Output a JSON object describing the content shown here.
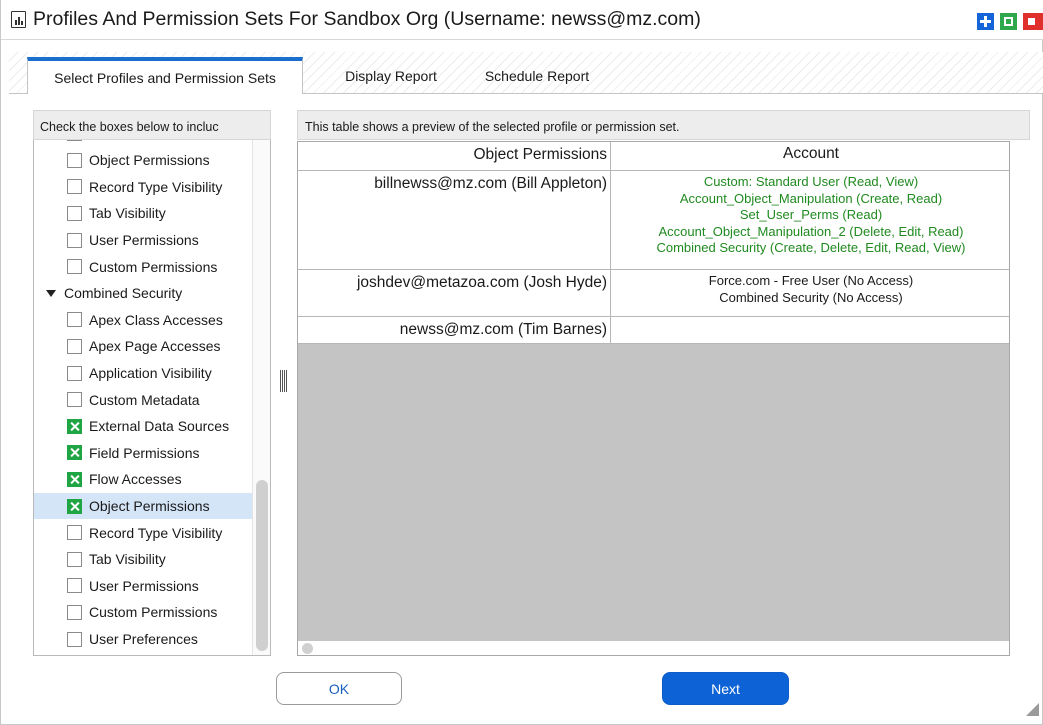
{
  "window": {
    "title": "Profiles And Permission Sets For Sandbox Org (Username: newss@mz.com)",
    "controls": [
      "maximize-icon",
      "restore-icon",
      "close-icon"
    ],
    "accent_colors": {
      "maximize": "#1565d8",
      "restore": "#2ea84a",
      "close": "#e0302c"
    }
  },
  "tabs": [
    {
      "label": "Select Profiles and Permission Sets",
      "active": true
    },
    {
      "label": "Display Report",
      "active": false
    },
    {
      "label": "Schedule Report",
      "active": false
    }
  ],
  "left_panel": {
    "header": "Check the boxes below to incluc",
    "items": [
      {
        "label": "Object Permissions",
        "checked": false
      },
      {
        "label": "Record Type Visibility",
        "checked": false
      },
      {
        "label": "Tab Visibility",
        "checked": false
      },
      {
        "label": "User Permissions",
        "checked": false
      },
      {
        "label": "Custom Permissions",
        "checked": false
      }
    ],
    "group": {
      "label": "Combined Security",
      "expanded": true
    },
    "group_items": [
      {
        "label": "Apex Class Accesses",
        "checked": false
      },
      {
        "label": "Apex Page Accesses",
        "checked": false
      },
      {
        "label": "Application Visibility",
        "checked": false
      },
      {
        "label": "Custom Metadata",
        "checked": false
      },
      {
        "label": "External Data Sources",
        "checked": true
      },
      {
        "label": "Field Permissions",
        "checked": true
      },
      {
        "label": "Flow Accesses",
        "checked": true
      },
      {
        "label": "Object Permissions",
        "checked": true,
        "selected": true
      },
      {
        "label": "Record Type Visibility",
        "checked": false
      },
      {
        "label": "Tab Visibility",
        "checked": false
      },
      {
        "label": "User Permissions",
        "checked": false
      },
      {
        "label": "Custom Permissions",
        "checked": false
      },
      {
        "label": "User Preferences",
        "checked": false
      }
    ]
  },
  "right_panel": {
    "header": "This table shows a preview of the selected profile or permission set.",
    "columns": [
      "Object Permissions",
      "Account"
    ],
    "rows": [
      {
        "user": "billnewss@mz.com (Bill Appleton)",
        "tone": "green",
        "lines": [
          "Custom: Standard User (Read, View)",
          "Account_Object_Manipulation (Create, Read)",
          "Set_User_Perms (Read)",
          "Account_Object_Manipulation_2 (Delete, Edit, Read)",
          "Combined Security (Create, Delete, Edit, Read, View)"
        ]
      },
      {
        "user": "joshdev@metazoa.com (Josh Hyde)",
        "tone": "dark",
        "lines": [
          "Force.com - Free User (No Access)",
          "Combined Security (No Access)"
        ]
      },
      {
        "user": "newss@mz.com (Tim Barnes)",
        "tone": "dark",
        "lines": []
      }
    ]
  },
  "buttons": {
    "ok": "OK",
    "next": "Next"
  }
}
